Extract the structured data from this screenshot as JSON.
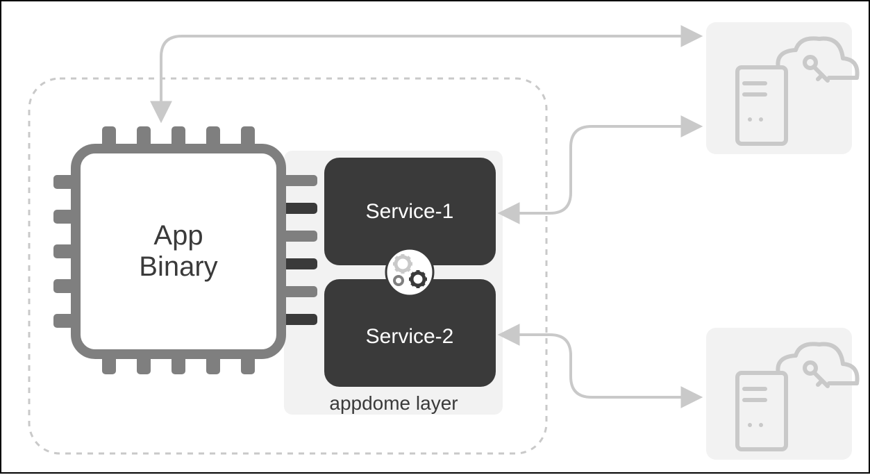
{
  "chip": {
    "line1": "App",
    "line2": "Binary"
  },
  "services": {
    "top": "Service-1",
    "bottom": "Service-2"
  },
  "layerLabel": "appdome layer",
  "colors": {
    "dark": "#3a3a3a",
    "gray": "#7f7f7f",
    "light": "#c9c9c9",
    "panel": "#f2f2f2",
    "serverPanel": "#f2f2f2"
  },
  "icons": {
    "chip": "chip-icon",
    "gears": "gears-icon",
    "serverTop": "server-key-icon",
    "serverBottom": "server-key-icon"
  }
}
